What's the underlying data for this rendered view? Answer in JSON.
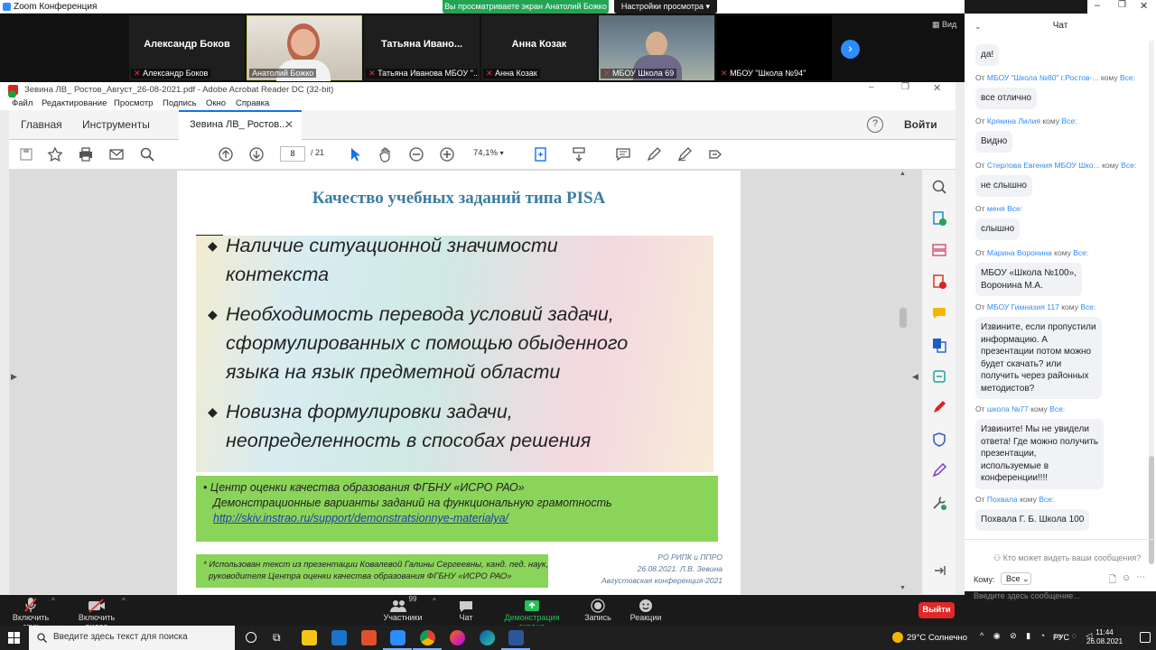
{
  "zoom_window": {
    "title": "Zoom Конференция",
    "share_banner": "Вы просматриваете экран Анатолий Божко",
    "view_options": "Настройки просмотра ▾",
    "view_label": "Вид"
  },
  "participants": [
    {
      "display": "Александр Боков",
      "caption": "Александр Боков",
      "video": false
    },
    {
      "display": "",
      "caption": "Анатолий Божко",
      "video": true
    },
    {
      "display": "Татьяна Ивано...",
      "caption": "Татьяна Иванова МБОУ \"...",
      "video": false
    },
    {
      "display": "Анна Козак",
      "caption": "Анна Козак",
      "video": false
    },
    {
      "display": "",
      "caption": "МБОУ Школа 69",
      "video": true
    },
    {
      "display": "",
      "caption": "МБОУ \"Школа №94\"",
      "video": false
    }
  ],
  "acrobat": {
    "title": "Зевина ЛВ_ Ростов_Август_26-08-2021.pdf - Adobe Acrobat Reader DC (32-bit)",
    "menu": [
      "Файл",
      "Редактирование",
      "Просмотр",
      "Подпись",
      "Окно",
      "Справка"
    ],
    "tab_home": "Главная",
    "tab_tools": "Инструменты",
    "tab_doc": "Зевина ЛВ_ Ростов...",
    "signin": "Войти",
    "page_current": "8",
    "page_total": "/ 21",
    "zoom": "74,1%"
  },
  "slide": {
    "title": "Качество учебных заданий типа PISA",
    "bullets": [
      [
        "Наличие ситуационной значимости",
        "контекста"
      ],
      [
        "Необходимость перевода условий задачи,",
        "сформулированных с помощью обыденного",
        "языка на язык предметной области"
      ],
      [
        "Новизна формулировки задачи,",
        "неопределенность в способах решения"
      ]
    ],
    "source_line1": "•  Центр оценки качества образования ФГБНУ «ИСРО РАО»",
    "source_line2": "Демонстрационные варианты заданий на функциональную грамотность",
    "source_link": "http://skiv.instrao.ru/support/demonstratsionnye-materialya/",
    "note_line1": "*  Использован текст из презентации Ковалевой Галины Сергеевны, канд. пед. наук,",
    "note_line2": "руководителя Центра оценки качества образования ФГБНУ «ИСРО РАО»",
    "sig1": "РО РИПК и ППРО",
    "sig2": "26.08.2021. Л.В. Зевина",
    "sig3": "Августовская  конференция-2021"
  },
  "chat": {
    "title": "Чат",
    "messages": [
      {
        "from": "",
        "to": "",
        "text": "да!"
      },
      {
        "from": "МБОУ \"Школа №80\" г.Ростов-...",
        "to": "Все:",
        "text": "все отлично"
      },
      {
        "from": "Крякина Лилия",
        "to": "Все:",
        "text": "Видно"
      },
      {
        "from": "Стерлова Евгения МБОУ Шко...",
        "to": "Все:",
        "text": "не слышно"
      },
      {
        "from": "меня",
        "to": "Все:",
        "text": "слышно"
      },
      {
        "from": "Марина Воронина",
        "to": "Все:",
        "text": "МБОУ «Школа №100»,\nВоронина М.А."
      },
      {
        "from": "МБОУ Гимназия 117",
        "to": "Все:",
        "text": "Извините, если пропустили\nинформацию. А\nпрезентации потом можно\nбудет скачать? или\nполучить через районных\nметодистов?"
      },
      {
        "from": "школа №77",
        "to": "Все:",
        "text": "Извините! Мы не увидели\nответа! Где можно получить\nпрезентации,\nиспользуемые в\nконференции!!!!"
      },
      {
        "from": "Похвала",
        "to": "Все:",
        "text": "Похвала Г. Б. Школа 100"
      }
    ],
    "label_from": "От",
    "label_to": "кому",
    "who_can_see": "Кто может видеть ваши сообщения?",
    "to_label": "Кому:",
    "to_value": "Все ⌄",
    "input_placeholder": "Введите здесь сообщение..."
  },
  "controls": {
    "mute": "Включить звук",
    "video": "Включить видео",
    "participants": "Участники",
    "participants_count": "99",
    "chat": "Чат",
    "share": "Демонстрация экрана",
    "record": "Запись",
    "reactions": "Реакции",
    "leave": "Выйти"
  },
  "taskbar": {
    "search_placeholder": "Введите здесь текст для поиска",
    "weather": "29°C  Солнечно",
    "lang": "РУС",
    "time": "11:44",
    "date": "26.08.2021"
  },
  "colors": {
    "zoom_blue": "#2d8cff",
    "share_green": "#23a455",
    "leave_red": "#e02828",
    "slide_green": "#8bd45a"
  }
}
